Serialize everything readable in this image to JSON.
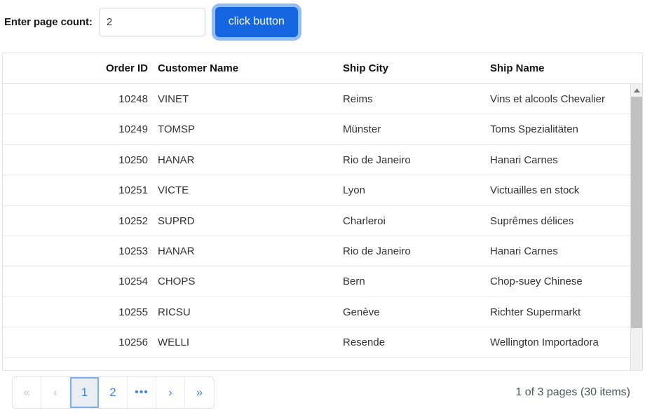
{
  "toolbar": {
    "label": "Enter page count:",
    "input_value": "2",
    "input_placeholder": "",
    "button_label": "click button"
  },
  "grid": {
    "columns": [
      {
        "key": "order_id",
        "label": "Order ID",
        "align": "right"
      },
      {
        "key": "customer_name",
        "label": "Customer Name",
        "align": "left"
      },
      {
        "key": "ship_city",
        "label": "Ship City",
        "align": "left"
      },
      {
        "key": "ship_name",
        "label": "Ship Name",
        "align": "left"
      }
    ],
    "rows": [
      {
        "order_id": "10248",
        "customer_name": "VINET",
        "ship_city": "Reims",
        "ship_name": "Vins et alcools Chevalier"
      },
      {
        "order_id": "10249",
        "customer_name": "TOMSP",
        "ship_city": "Münster",
        "ship_name": "Toms Spezialitäten"
      },
      {
        "order_id": "10250",
        "customer_name": "HANAR",
        "ship_city": "Rio de Janeiro",
        "ship_name": "Hanari Carnes"
      },
      {
        "order_id": "10251",
        "customer_name": "VICTE",
        "ship_city": "Lyon",
        "ship_name": "Victuailles en stock"
      },
      {
        "order_id": "10252",
        "customer_name": "SUPRD",
        "ship_city": "Charleroi",
        "ship_name": "Suprêmes délices"
      },
      {
        "order_id": "10253",
        "customer_name": "HANAR",
        "ship_city": "Rio de Janeiro",
        "ship_name": "Hanari Carnes"
      },
      {
        "order_id": "10254",
        "customer_name": "CHOPS",
        "ship_city": "Bern",
        "ship_name": "Chop-suey Chinese"
      },
      {
        "order_id": "10255",
        "customer_name": "RICSU",
        "ship_city": "Genève",
        "ship_name": "Richter Supermarkt"
      },
      {
        "order_id": "10256",
        "customer_name": "WELLI",
        "ship_city": "Resende",
        "ship_name": "Wellington Importadora"
      },
      {
        "order_id": "",
        "customer_name": "",
        "ship_city": "",
        "ship_name": ""
      }
    ]
  },
  "pager": {
    "buttons": [
      {
        "id": "first",
        "label": "«",
        "state": "disabled"
      },
      {
        "id": "previous",
        "label": "‹",
        "state": "disabled"
      },
      {
        "id": "page-1",
        "label": "1",
        "state": "active"
      },
      {
        "id": "page-2",
        "label": "2",
        "state": "enabled"
      },
      {
        "id": "ellipsis",
        "label": "•••",
        "state": "enabled"
      },
      {
        "id": "next",
        "label": "›",
        "state": "enabled"
      },
      {
        "id": "last",
        "label": "»",
        "state": "enabled"
      }
    ],
    "status": "1 of 3 pages (30 items)",
    "current_page": 1,
    "total_pages": 3,
    "total_items": 30
  },
  "scrollbar": {
    "up_icon": "triangle-up-icon",
    "down_icon": "triangle-down-icon",
    "orientation": "vertical"
  },
  "colors": {
    "accent": "#1566e0",
    "link": "#4285f4",
    "active_page_bg": "#e9eef3",
    "active_page_border": "#7cb0ef",
    "focus_ring": "#6da8f5",
    "border": "#e0e0e0",
    "scroll_thumb": "#c1c1c1"
  }
}
